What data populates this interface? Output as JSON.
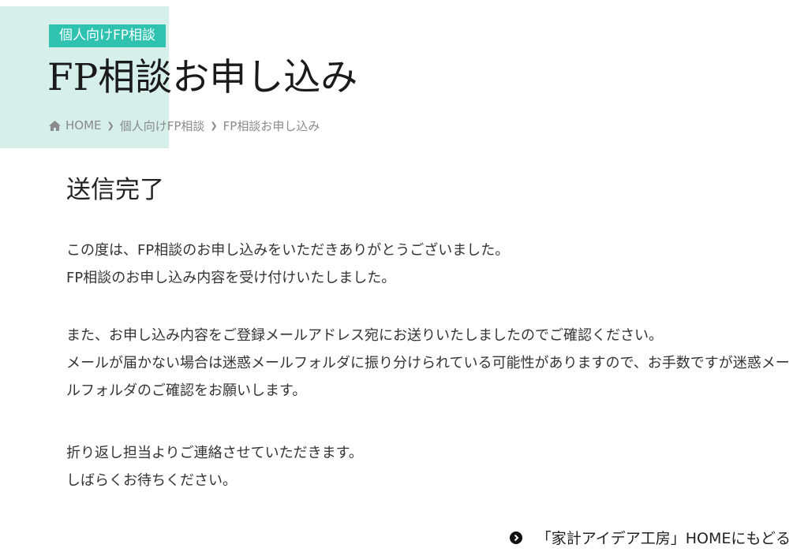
{
  "header": {
    "category_badge": "個人向けFP相談",
    "title": "FP相談お申し込み"
  },
  "breadcrumb": {
    "icon": "home-icon",
    "items": [
      "HOME",
      "個人向けFP相談",
      "FP相談お申し込み"
    ]
  },
  "content": {
    "heading": "送信完了",
    "paragraphs": [
      [
        "この度は、FP相談のお申し込みをいただきありがとうございました。",
        "FP相談のお申し込み内容を受け付けいたしました。"
      ],
      [
        "また、お申し込み内容をご登録メールアドレス宛にお送りいたしましたのでご確認ください。",
        "メールが届かない場合は迷惑メールフォルダに振り分けられている可能性がありますので、お手数ですが迷惑メールフォルダのご確認をお願いします。"
      ],
      [
        "折り返し担当よりご連絡させていただきます。",
        "しばらくお待ちください。"
      ]
    ]
  },
  "footer_link": {
    "label": "「家計アイデア工房」HOMEにもどる",
    "icon": "circle-chevron-right-icon"
  },
  "colors": {
    "accent": "#2fc2b0",
    "hero_background": "#d6efe8"
  }
}
